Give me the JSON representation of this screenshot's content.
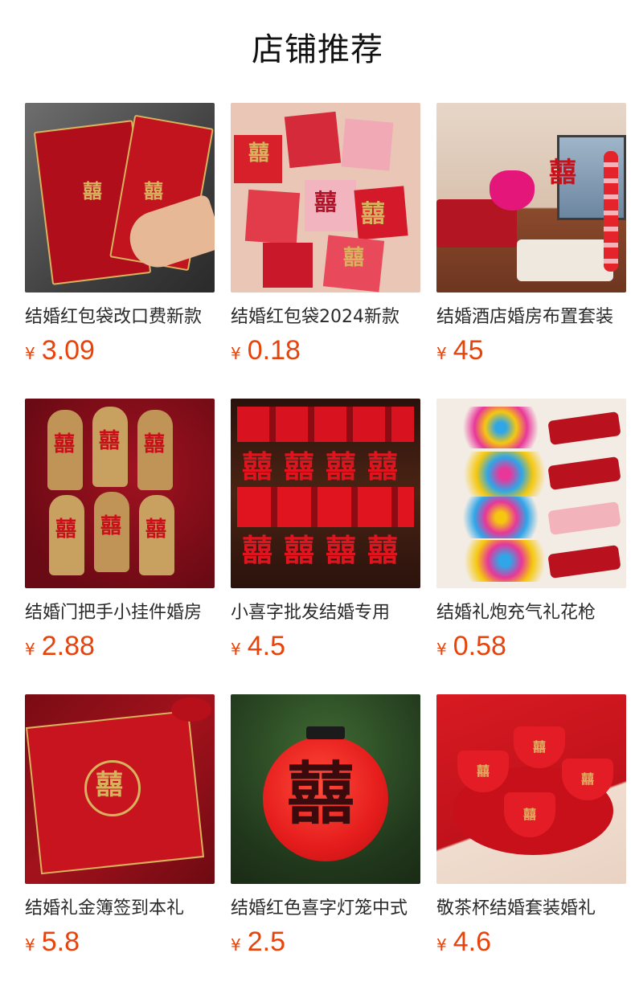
{
  "header": {
    "title": "店铺推荐"
  },
  "colors": {
    "price": "#e8430b",
    "accent_red": "#c8101a",
    "gold": "#d9b25e"
  },
  "products": [
    {
      "name": "结婚红包袋改口费新款",
      "currency": "¥",
      "price": "3.09",
      "image_icon": "red-envelope-icon"
    },
    {
      "name": "结婚红包袋2024新款",
      "currency": "¥",
      "price": "0.18",
      "image_icon": "red-envelope-pack-icon"
    },
    {
      "name": "结婚酒店婚房布置套装",
      "currency": "¥",
      "price": "45",
      "image_icon": "wedding-room-icon"
    },
    {
      "name": "结婚门把手小挂件婚房",
      "currency": "¥",
      "price": "2.88",
      "image_icon": "door-hanger-icon"
    },
    {
      "name": "小喜字批发结婚专用",
      "currency": "¥",
      "price": "4.5",
      "image_icon": "xi-stickers-icon"
    },
    {
      "name": "结婚礼炮充气礼花枪",
      "currency": "¥",
      "price": "0.58",
      "image_icon": "confetti-cannon-icon"
    },
    {
      "name": "结婚礼金簿签到本礼",
      "currency": "¥",
      "price": "5.8",
      "image_icon": "guest-book-icon"
    },
    {
      "name": "结婚红色喜字灯笼中式",
      "currency": "¥",
      "price": "2.5",
      "image_icon": "lantern-icon"
    },
    {
      "name": "敬茶杯结婚套装婚礼",
      "currency": "¥",
      "price": "4.6",
      "image_icon": "tea-set-icon"
    }
  ]
}
